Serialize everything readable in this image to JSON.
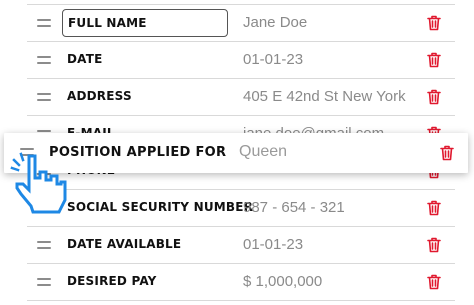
{
  "rows": [
    {
      "label": "FULL NAME",
      "value": "Jane Doe"
    },
    {
      "label": "DATE",
      "value": "01-01-23"
    },
    {
      "label": "ADDRESS",
      "value": "405 E 42nd St New York"
    },
    {
      "label": "E-MAIL",
      "value": "jane.doe@gmail.com"
    },
    {
      "label": "PHONE",
      "value": ""
    },
    {
      "label": "SOCIAL SECURITY NUMBER",
      "value": "987 - 654 - 321"
    },
    {
      "label": "DATE AVAILABLE",
      "value": "01-01-23"
    },
    {
      "label": "DESIRED PAY",
      "value": "$ 1,000,000"
    }
  ],
  "dragging": {
    "label": "POSITION APPLIED FOR",
    "value": "Queen"
  },
  "colors": {
    "trash": "#e0192f",
    "cursor": "#1e88e5"
  },
  "icons": {
    "handle": "drag-handle-icon",
    "delete": "trash-icon",
    "cursor": "hand-pointer-icon"
  }
}
